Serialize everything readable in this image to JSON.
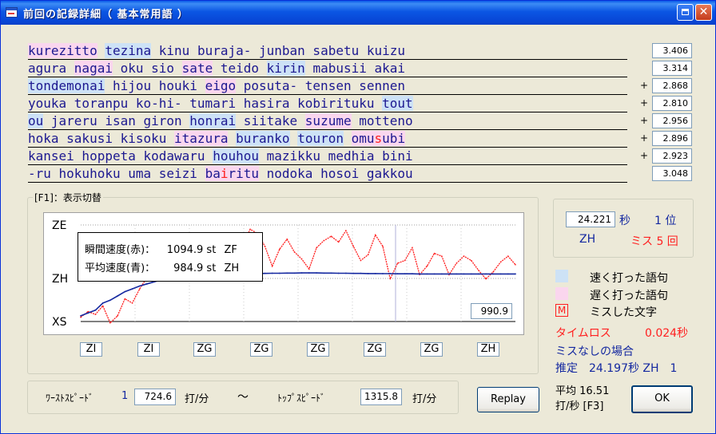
{
  "window": {
    "title": "前回の記録詳細（ 基本常用語 ）",
    "maximize_label": "",
    "close_label": "✕"
  },
  "lines": [
    {
      "time": "3.406",
      "plus": "",
      "words": [
        {
          "segs": [
            {
              "t": "kurezitto"
            }
          ],
          "hl": "slow"
        },
        {
          "segs": [
            {
              "t": " "
            }
          ]
        },
        {
          "segs": [
            {
              "t": "tezina"
            }
          ],
          "hl": "fast"
        },
        {
          "segs": [
            {
              "t": " kinu buraja- junban sabetu kuizu "
            }
          ]
        }
      ]
    },
    {
      "time": "3.314",
      "plus": "",
      "words": [
        {
          "segs": [
            {
              "t": "agura "
            }
          ]
        },
        {
          "segs": [
            {
              "t": "nagai"
            }
          ],
          "hl": "slow"
        },
        {
          "segs": [
            {
              "t": " oku sio "
            }
          ]
        },
        {
          "segs": [
            {
              "t": "sate"
            }
          ],
          "hl": "slow"
        },
        {
          "segs": [
            {
              "t": " teido "
            }
          ]
        },
        {
          "segs": [
            {
              "t": "kirin"
            }
          ],
          "hl": "fast"
        },
        {
          "segs": [
            {
              "t": " mabusii akai "
            }
          ]
        }
      ]
    },
    {
      "time": "2.868",
      "plus": "+",
      "words": [
        {
          "segs": [
            {
              "t": "tondemonai"
            }
          ],
          "hl": "fast"
        },
        {
          "segs": [
            {
              "t": " hijou houki "
            }
          ]
        },
        {
          "segs": [
            {
              "t": "eigo"
            }
          ],
          "hl": "slow"
        },
        {
          "segs": [
            {
              "t": " posuta- tensen sennen "
            }
          ]
        }
      ]
    },
    {
      "time": "2.810",
      "plus": "+",
      "words": [
        {
          "segs": [
            {
              "t": "youka toranpu ko-hi- tumari hasira kobirituku "
            }
          ]
        },
        {
          "segs": [
            {
              "t": "tout"
            }
          ],
          "hl": "fast"
        }
      ]
    },
    {
      "time": "2.956",
      "plus": "+",
      "words": [
        {
          "segs": [
            {
              "t": "ou"
            }
          ],
          "hl": "fast"
        },
        {
          "segs": [
            {
              "t": " jareru isan giron "
            }
          ]
        },
        {
          "segs": [
            {
              "t": "honrai"
            }
          ],
          "hl": "fast"
        },
        {
          "segs": [
            {
              "t": " siitake "
            }
          ]
        },
        {
          "segs": [
            {
              "t": "suzume"
            }
          ],
          "hl": "slow"
        },
        {
          "segs": [
            {
              "t": " motteno "
            }
          ]
        }
      ]
    },
    {
      "time": "2.896",
      "plus": "+",
      "words": [
        {
          "segs": [
            {
              "t": "hoka sakusi kisoku "
            }
          ]
        },
        {
          "segs": [
            {
              "t": "itazura"
            }
          ],
          "hl": "slow"
        },
        {
          "segs": [
            {
              "t": " "
            }
          ]
        },
        {
          "segs": [
            {
              "t": "buranko"
            }
          ],
          "hl": "fast"
        },
        {
          "segs": [
            {
              "t": " "
            }
          ]
        },
        {
          "segs": [
            {
              "t": "touron"
            }
          ],
          "hl": "fast"
        },
        {
          "segs": [
            {
              "t": " "
            }
          ]
        },
        {
          "segs": [
            {
              "t": "omu"
            },
            {
              "t": "s",
              "miss": true
            },
            {
              "t": "ubi"
            }
          ],
          "hl": "slow"
        },
        {
          "segs": [
            {
              "t": " "
            }
          ]
        }
      ]
    },
    {
      "time": "2.923",
      "plus": "+",
      "words": [
        {
          "segs": [
            {
              "t": "kansei hoppeta kodawaru "
            }
          ]
        },
        {
          "segs": [
            {
              "t": "houhou"
            }
          ],
          "hl": "fast"
        },
        {
          "segs": [
            {
              "t": " mazikku medhia bini "
            }
          ]
        }
      ]
    },
    {
      "time": "3.048",
      "plus": "",
      "words": [
        {
          "segs": [
            {
              "t": "-ru hokuhoku uma seizi "
            }
          ]
        },
        {
          "segs": [
            {
              "t": "ba"
            },
            {
              "t": "i",
              "miss": true
            },
            {
              "t": "ritu"
            }
          ],
          "hl": "slow"
        },
        {
          "segs": [
            {
              "t": " nodoka hosoi gakkou"
            }
          ]
        }
      ]
    }
  ],
  "graph_group": {
    "label": "[F1]：表示切替",
    "legend": {
      "inst_label": "瞬間速度(赤)：",
      "inst_value": "1094.9 st",
      "inst_grade": "ZF",
      "avg_label": "平均速度(青)：",
      "avg_value": "984.9 st",
      "avg_grade": "ZH"
    },
    "cursor_value": "990.9",
    "grades": [
      "ZI",
      "ZI",
      "ZG",
      "ZG",
      "ZG",
      "ZG",
      "ZG",
      "ZH"
    ]
  },
  "chart_data": {
    "type": "line",
    "title": "",
    "xlabel": "",
    "ylabel": "",
    "y_tick_labels": [
      "ZE",
      "ZH",
      "XS"
    ],
    "grid": true,
    "series": [
      {
        "name": "瞬間速度(赤)",
        "color": "#ff1e1e",
        "values": [
          680,
          720,
          700,
          760,
          640,
          690,
          810,
          780,
          880,
          960,
          1080,
          1150,
          990,
          1190,
          1250,
          1110,
          1150,
          1240,
          1210,
          1160,
          1080,
          1100,
          1190,
          1300,
          1270,
          1180,
          1040,
          1160,
          1230,
          1140,
          1090,
          1020,
          1170,
          1220,
          1250,
          1210,
          1290,
          1180,
          1080,
          1120,
          1260,
          1180,
          950,
          1060,
          1080,
          1170,
          980,
          1040,
          1130,
          1110,
          980,
          1060,
          1110,
          1080,
          1010,
          950,
          1000,
          1070,
          1110,
          1050
        ]
      },
      {
        "name": "平均速度(青)",
        "color": "#1428a0",
        "values": [
          690,
          710,
          730,
          780,
          800,
          830,
          860,
          880,
          900,
          915,
          930,
          945,
          955,
          960,
          965,
          970,
          972,
          975,
          978,
          980,
          982,
          984,
          985,
          986,
          988,
          989,
          990,
          990,
          991,
          991,
          992,
          992,
          992,
          991,
          991,
          990,
          990,
          989,
          989,
          988,
          988,
          987,
          987,
          986,
          986,
          986,
          985,
          985,
          985,
          985,
          985,
          985,
          985,
          985,
          985,
          985,
          985,
          985,
          985,
          985
        ]
      }
    ]
  },
  "legend_right": {
    "total_time": "24.221",
    "sec_unit": "秒",
    "rank": "1 位",
    "grade": "ZH",
    "miss": "ミス 5 回",
    "fast_label": "速く打った語句",
    "slow_label": "遅く打った語句",
    "miss_label": "ミスした文字",
    "miss_icon": "M",
    "timeloss_label": "タイムロス",
    "timeloss_value": "0.024秒",
    "nomiss_label": "ミスなしの場合",
    "estimate": "推定　24.197秒 ZH　1"
  },
  "colors": {
    "fast": "#cde2f6",
    "slow": "#fad6ee",
    "miss": "#ff2020",
    "word_text": "#1c1890"
  },
  "speed": {
    "worst_label": "ﾜｰｽﾄｽﾋﾟｰﾄﾞ",
    "worst_rank": "1",
    "worst_value": "724.6",
    "unit": "打/分",
    "tilde": "～",
    "top_label": "ﾄｯﾌﾟｽﾋﾟｰﾄﾞ",
    "top_value": "1315.8"
  },
  "buttons": {
    "replay": "Replay",
    "ok": "OK"
  },
  "avg": {
    "line1": "平均 16.51",
    "line2": "打/秒 [F3]"
  }
}
